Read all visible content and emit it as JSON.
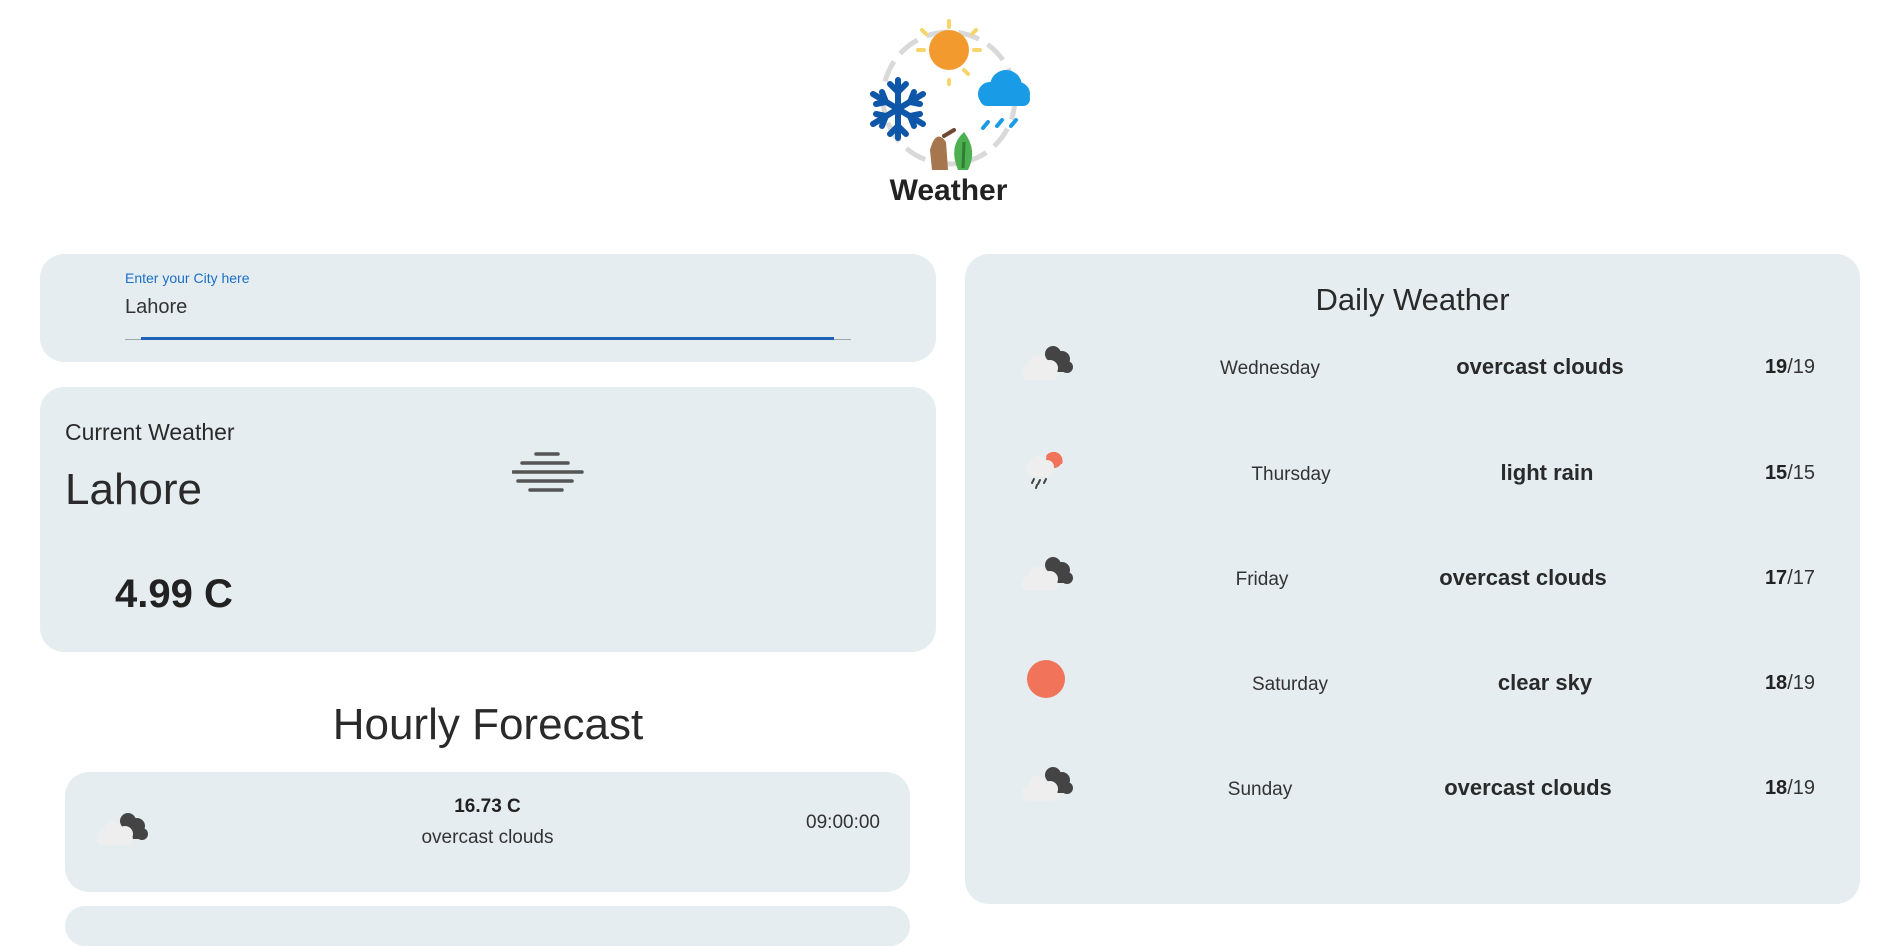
{
  "app": {
    "title": "Weather"
  },
  "search": {
    "label": "Enter your City here",
    "value": "Lahore"
  },
  "current": {
    "heading": "Current Weather",
    "city": "Lahore",
    "temperature": "4.99 C",
    "icon": "fog-icon"
  },
  "hourly": {
    "title": "Hourly Forecast",
    "items": [
      {
        "temp": "16.73 C",
        "description": "overcast clouds",
        "time": "09:00:00",
        "icon": "overcast-clouds-icon"
      }
    ]
  },
  "daily": {
    "title": "Daily Weather",
    "items": [
      {
        "day": "Wednesday",
        "description": "overcast clouds",
        "max": "19",
        "sep": "/",
        "min": "19",
        "icon": "overcast-clouds-icon"
      },
      {
        "day": "Thursday",
        "description": "light rain",
        "max": "15",
        "sep": "/",
        "min": "15",
        "icon": "light-rain-icon"
      },
      {
        "day": "Friday",
        "description": "overcast clouds",
        "max": "17",
        "sep": "/",
        "min": "17",
        "icon": "overcast-clouds-icon"
      },
      {
        "day": "Saturday",
        "description": "clear sky",
        "max": "18",
        "sep": "/",
        "min": "19",
        "icon": "clear-sky-icon"
      },
      {
        "day": "Sunday",
        "description": "overcast clouds",
        "max": "18",
        "sep": "/",
        "min": "19",
        "icon": "overcast-clouds-icon"
      }
    ]
  },
  "colors": {
    "panel": "#e5edf0",
    "accent": "#1c63b8",
    "sun": "#f0735a",
    "cloud_dark": "#444444",
    "cloud_light": "#eeeeee"
  }
}
